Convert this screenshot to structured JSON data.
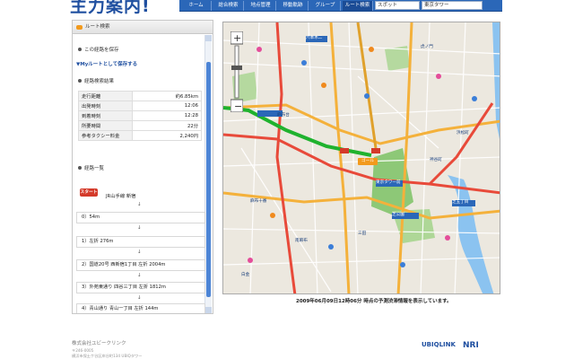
{
  "header": {
    "logo_text": "主力案内!",
    "tabs": [
      {
        "label": "ホーム"
      },
      {
        "label": "総合検索"
      },
      {
        "label": "地点管理"
      },
      {
        "label": "移動軌跡"
      },
      {
        "label": "グループ"
      },
      {
        "label": "ルート検索",
        "active": true
      }
    ],
    "search_category": "スポット",
    "search_value": "東京タワー"
  },
  "sidebar": {
    "title": "ルート検索",
    "save_section": "この経路を保存",
    "save_link": "▼Myルートとして保存する",
    "results_section": "経路検索結果",
    "results": [
      {
        "label": "走行距離",
        "value": "約6.85km"
      },
      {
        "label": "出発時刻",
        "value": "12:06"
      },
      {
        "label": "到着時刻",
        "value": "12:28"
      },
      {
        "label": "所要時間",
        "value": "22分"
      },
      {
        "label": "参考タクシー料金",
        "value": "2,240円"
      }
    ],
    "list_section": "経路一覧",
    "start_badge": "スタート",
    "start_text": "JR山手線 新宿",
    "steps": [
      "0）54m",
      "1）左折 276m",
      "2）国道20号 西新宿1丁目 左折 2004m",
      "3）外苑東通り 四谷三丁目 左折 1812m",
      "4）青山通り 青山一丁目 左折 144m"
    ],
    "arrow": "↓"
  },
  "map": {
    "goal_label": "ゴール",
    "caption": "2009年06月09日12時06分 時点の予測渋滞情報を表示しています。",
    "place_labels": [
      "六本木二",
      "麻布台",
      "東京タワー前",
      "虎ノ門",
      "神谷町",
      "三田",
      "芝公園",
      "麻布十番",
      "白金",
      "浜松町",
      "芝五丁目",
      "南麻布"
    ]
  },
  "footer": {
    "company": "株式会社ユビークリンク",
    "sub_line1": "〒246-0005",
    "sub_line2": "横浜市保土ケ谷区岸谷町134 UBIQタワー",
    "partner1": "UBIQLINK",
    "partner2": "NRI"
  },
  "colors": {
    "nav_blue": "#2b67b8",
    "route_green": "#1fb22e",
    "park_green": "#7cc265",
    "water_blue": "#8bc3f0",
    "start_red": "#d43a2a"
  }
}
